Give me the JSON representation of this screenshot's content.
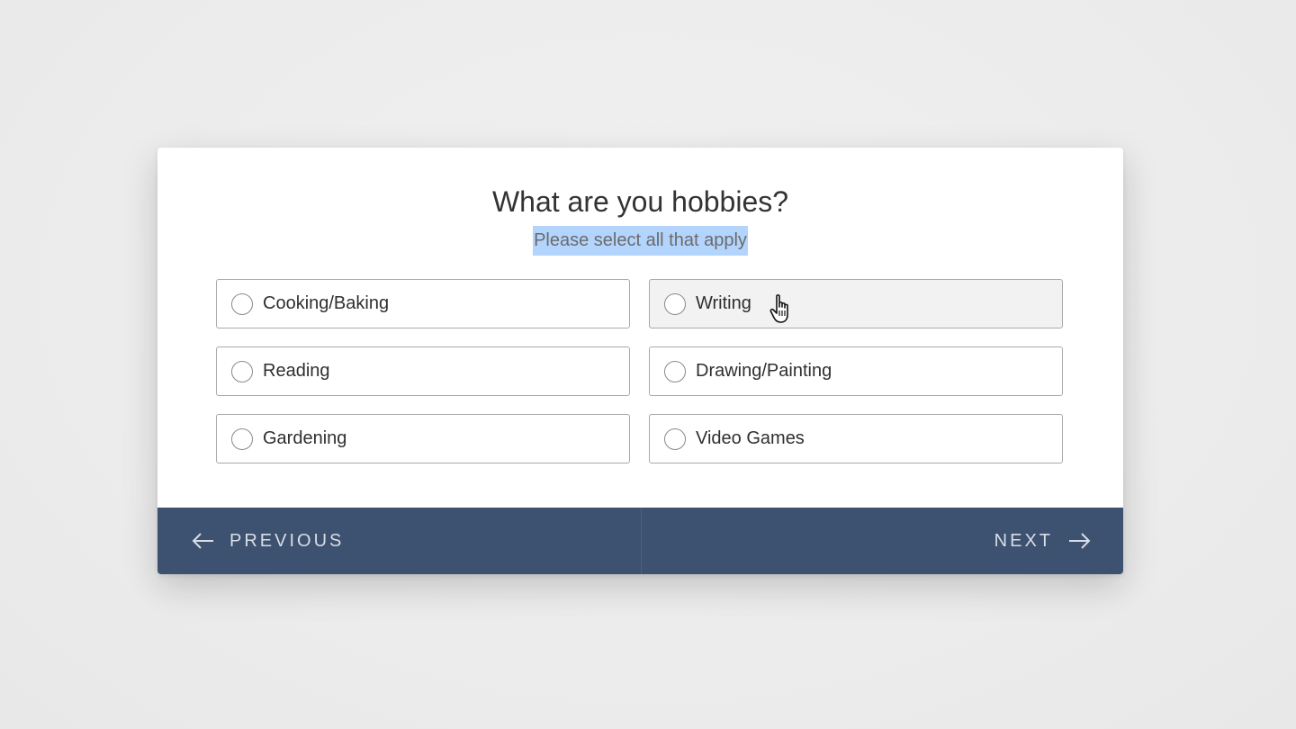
{
  "question": {
    "title": "What are you hobbies?",
    "subtitle": "Please select all that apply"
  },
  "options": [
    {
      "label": "Cooking/Baking",
      "selected": false
    },
    {
      "label": "Writing",
      "selected": false,
      "hovered": true
    },
    {
      "label": "Reading",
      "selected": false
    },
    {
      "label": "Drawing/Painting",
      "selected": false
    },
    {
      "label": "Gardening",
      "selected": false
    },
    {
      "label": "Video Games",
      "selected": false
    }
  ],
  "footer": {
    "previous_label": "PREVIOUS",
    "next_label": "NEXT",
    "previous_icon": "arrow-left-icon",
    "next_icon": "arrow-right-icon"
  },
  "colors": {
    "footer_bg": "#3d5170",
    "selection_highlight": "#b3d4fc",
    "option_border": "#a9a9a9",
    "hover_bg": "#f2f2f2"
  }
}
